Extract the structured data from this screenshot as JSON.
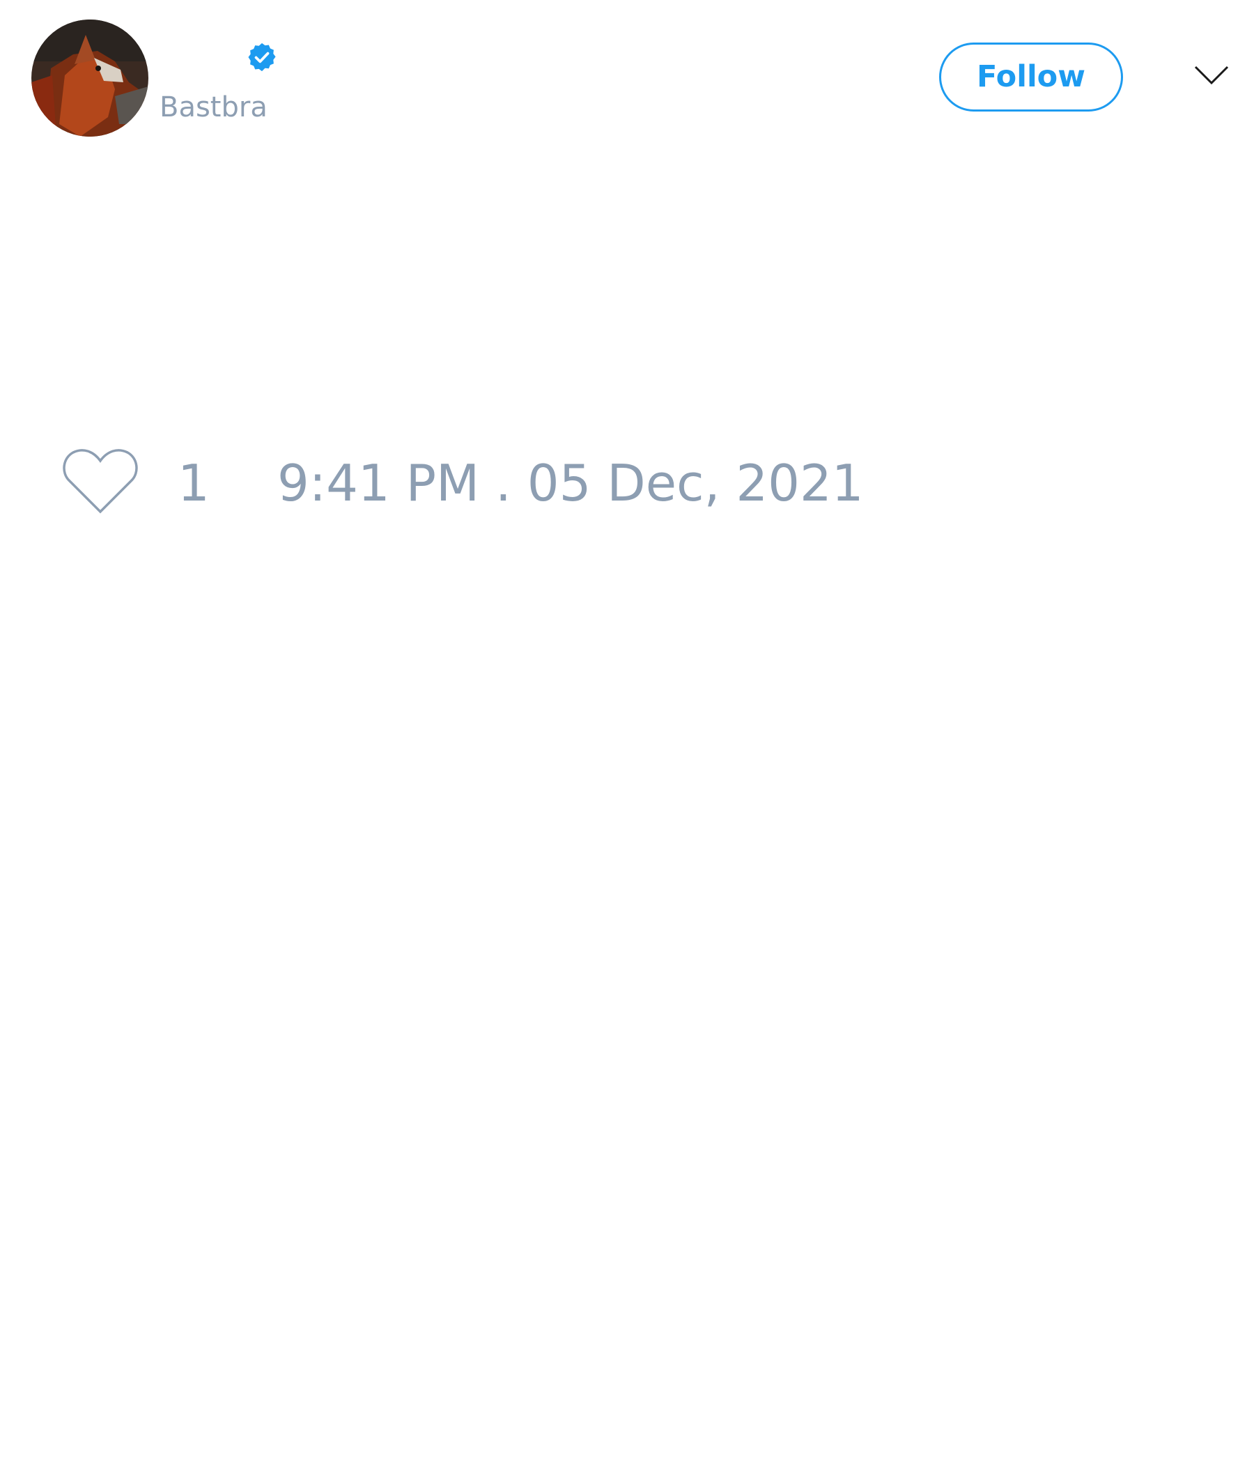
{
  "tweet": {
    "author": {
      "handle": "Bastbra",
      "verified_icon": "verified-badge-icon",
      "avatar_icon": "fox-avatar-image"
    },
    "follow_button": {
      "label": "Follow"
    },
    "menu_icon": "chevron-down-icon",
    "like_icon": "heart-outline-icon",
    "like_count": "1",
    "timestamp": "9:41 PM . 05 Dec, 2021"
  },
  "colors": {
    "accent": "#1d9bf0",
    "muted_text": "#8d9eb2",
    "background": "#ffffff",
    "icon_dark": "#1a1a1a"
  }
}
